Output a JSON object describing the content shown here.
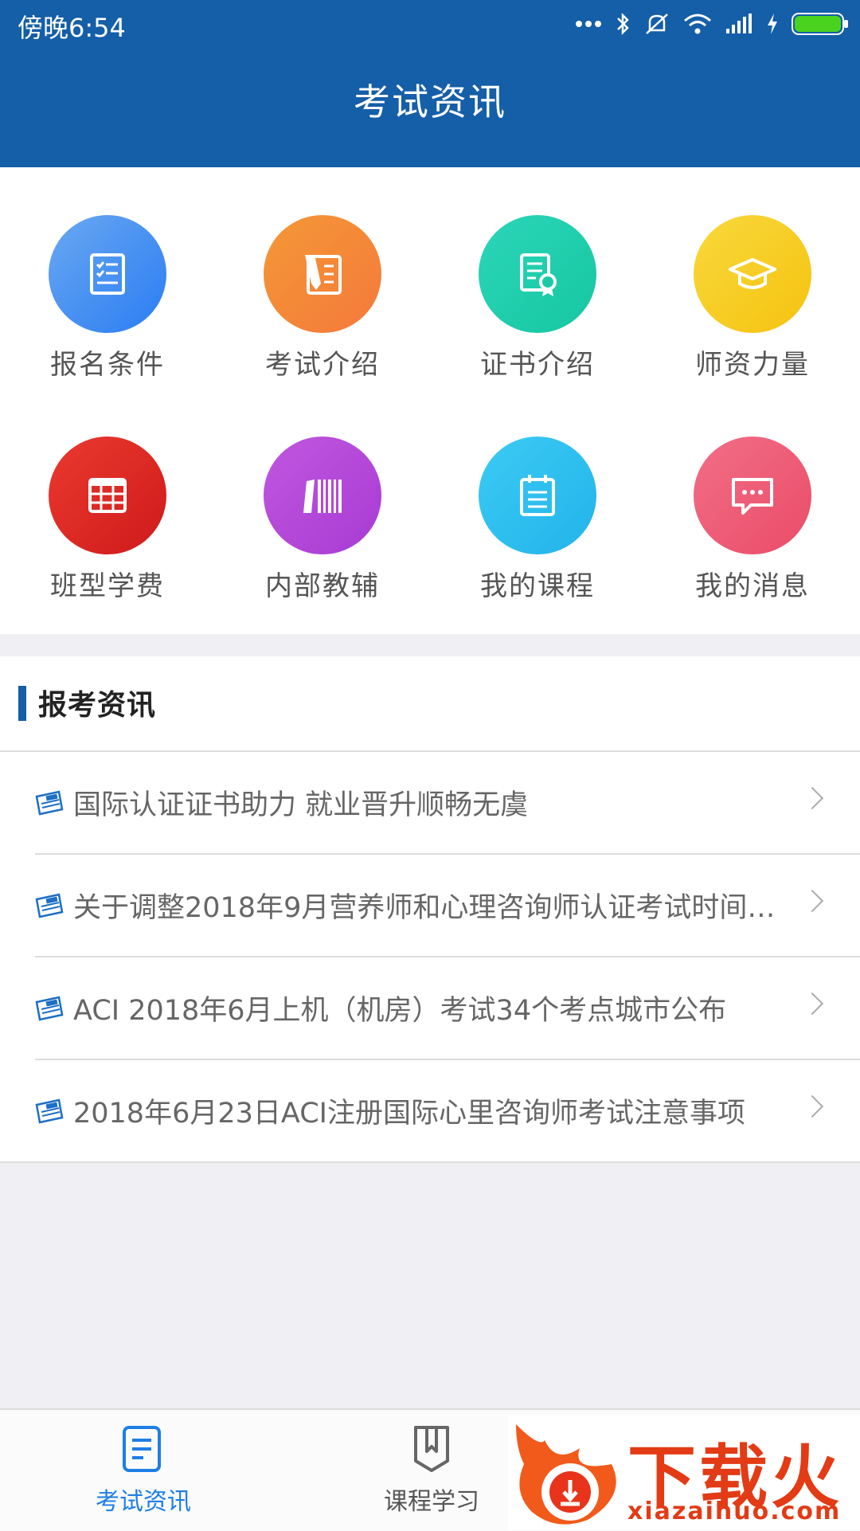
{
  "status_bar": {
    "time": "傍晚6:54"
  },
  "header": {
    "title": "考试资讯"
  },
  "menu": [
    {
      "label": "报名条件",
      "icon": "checklist-icon",
      "color_from": "#5aa3f0",
      "color_to": "#2b7ff2"
    },
    {
      "label": "考试介绍",
      "icon": "pen-paper-icon",
      "color_from": "#f48a3d",
      "color_to": "#f47a2f"
    },
    {
      "label": "证书介绍",
      "icon": "certificate-icon",
      "color_from": "#2bd2b5",
      "color_to": "#18c7a4"
    },
    {
      "label": "师资力量",
      "icon": "graduation-cap-icon",
      "color_from": "#f8d63a",
      "color_to": "#f6c311"
    },
    {
      "label": "班型学费",
      "icon": "table-icon",
      "color_from": "#e8372d",
      "color_to": "#d31d1d"
    },
    {
      "label": "内部教辅",
      "icon": "books-icon",
      "color_from": "#bb52dc",
      "color_to": "#a93ed6"
    },
    {
      "label": "我的课程",
      "icon": "notebook-icon",
      "color_from": "#35c6f2",
      "color_to": "#20b3ec"
    },
    {
      "label": "我的消息",
      "icon": "message-icon",
      "color_from": "#f06681",
      "color_to": "#ec4f6b"
    }
  ],
  "news": {
    "title": "报考资讯",
    "items": [
      "国际认证证书助力 就业晋升顺畅无虞",
      "关于调整2018年9月营养师和心理咨询师认证考试时间…",
      "ACI 2018年6月上机（机房）考试34个考点城市公布",
      "2018年6月23日ACI注册国际心里咨询师考试注意事项"
    ]
  },
  "tabs": [
    {
      "label": "考试资讯",
      "active": true
    },
    {
      "label": "课程学习",
      "active": false
    }
  ],
  "watermark": {
    "brand": "下载火",
    "url": "xiazaihuo.com"
  },
  "colors": {
    "primary": "#155ea8",
    "tab_active": "#1e7ee6"
  }
}
